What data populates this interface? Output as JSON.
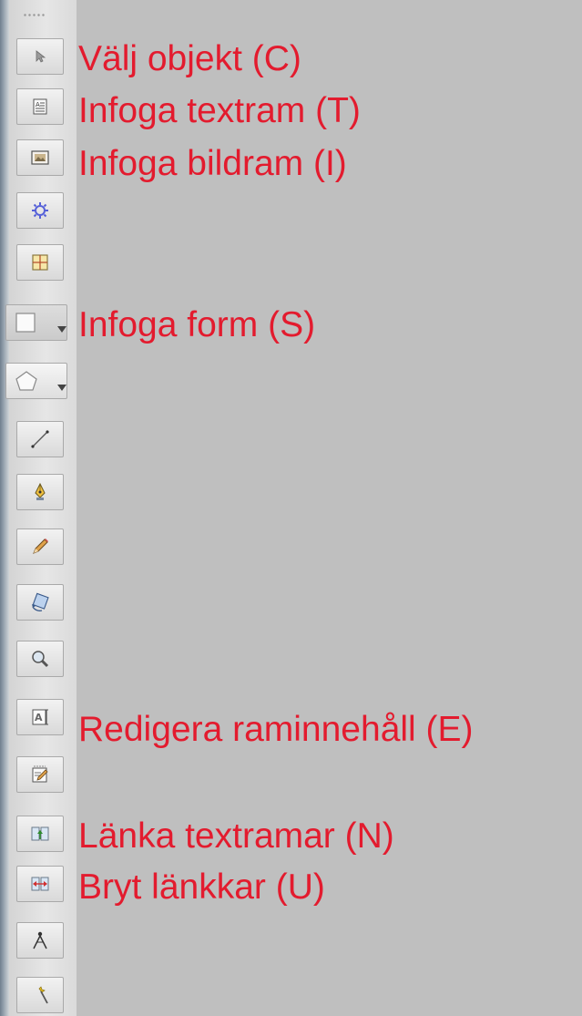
{
  "toolbar": {
    "tools": [
      {
        "id": "select",
        "icon": "select-arrow-icon",
        "label": "Välj objekt (C)"
      },
      {
        "id": "text-frame",
        "icon": "text-frame-icon",
        "label": "Infoga textram (T)"
      },
      {
        "id": "image-frame",
        "icon": "image-frame-icon",
        "label": "Infoga bildram (I)"
      },
      {
        "id": "render-frame",
        "icon": "render-frame-icon",
        "label": ""
      },
      {
        "id": "table",
        "icon": "table-icon",
        "label": ""
      },
      {
        "id": "shape",
        "icon": "rectangle-shape-icon",
        "label": "Infoga form (S)"
      },
      {
        "id": "polygon",
        "icon": "polygon-icon",
        "label": ""
      },
      {
        "id": "line",
        "icon": "line-icon",
        "label": ""
      },
      {
        "id": "bezier",
        "icon": "bezier-pen-icon",
        "label": ""
      },
      {
        "id": "freehand",
        "icon": "pencil-icon",
        "label": ""
      },
      {
        "id": "rotate",
        "icon": "rotate-icon",
        "label": ""
      },
      {
        "id": "zoom",
        "icon": "magnifier-icon",
        "label": ""
      },
      {
        "id": "edit-contents",
        "icon": "edit-frame-contents-icon",
        "label": "Redigera raminnehåll (E)"
      },
      {
        "id": "edit-text",
        "icon": "story-editor-icon",
        "label": ""
      },
      {
        "id": "link-frames",
        "icon": "link-text-frames-icon",
        "label": "Länka textramar (N)"
      },
      {
        "id": "unlink-frames",
        "icon": "unlink-text-frames-icon",
        "label": "Bryt länkkar (U)"
      },
      {
        "id": "measure",
        "icon": "measure-compass-icon",
        "label": ""
      },
      {
        "id": "eyedropper",
        "icon": "eyedropper-icon",
        "label": ""
      }
    ]
  },
  "colors": {
    "annotation_text": "#e31b2e",
    "background": "#bfbfbf"
  }
}
